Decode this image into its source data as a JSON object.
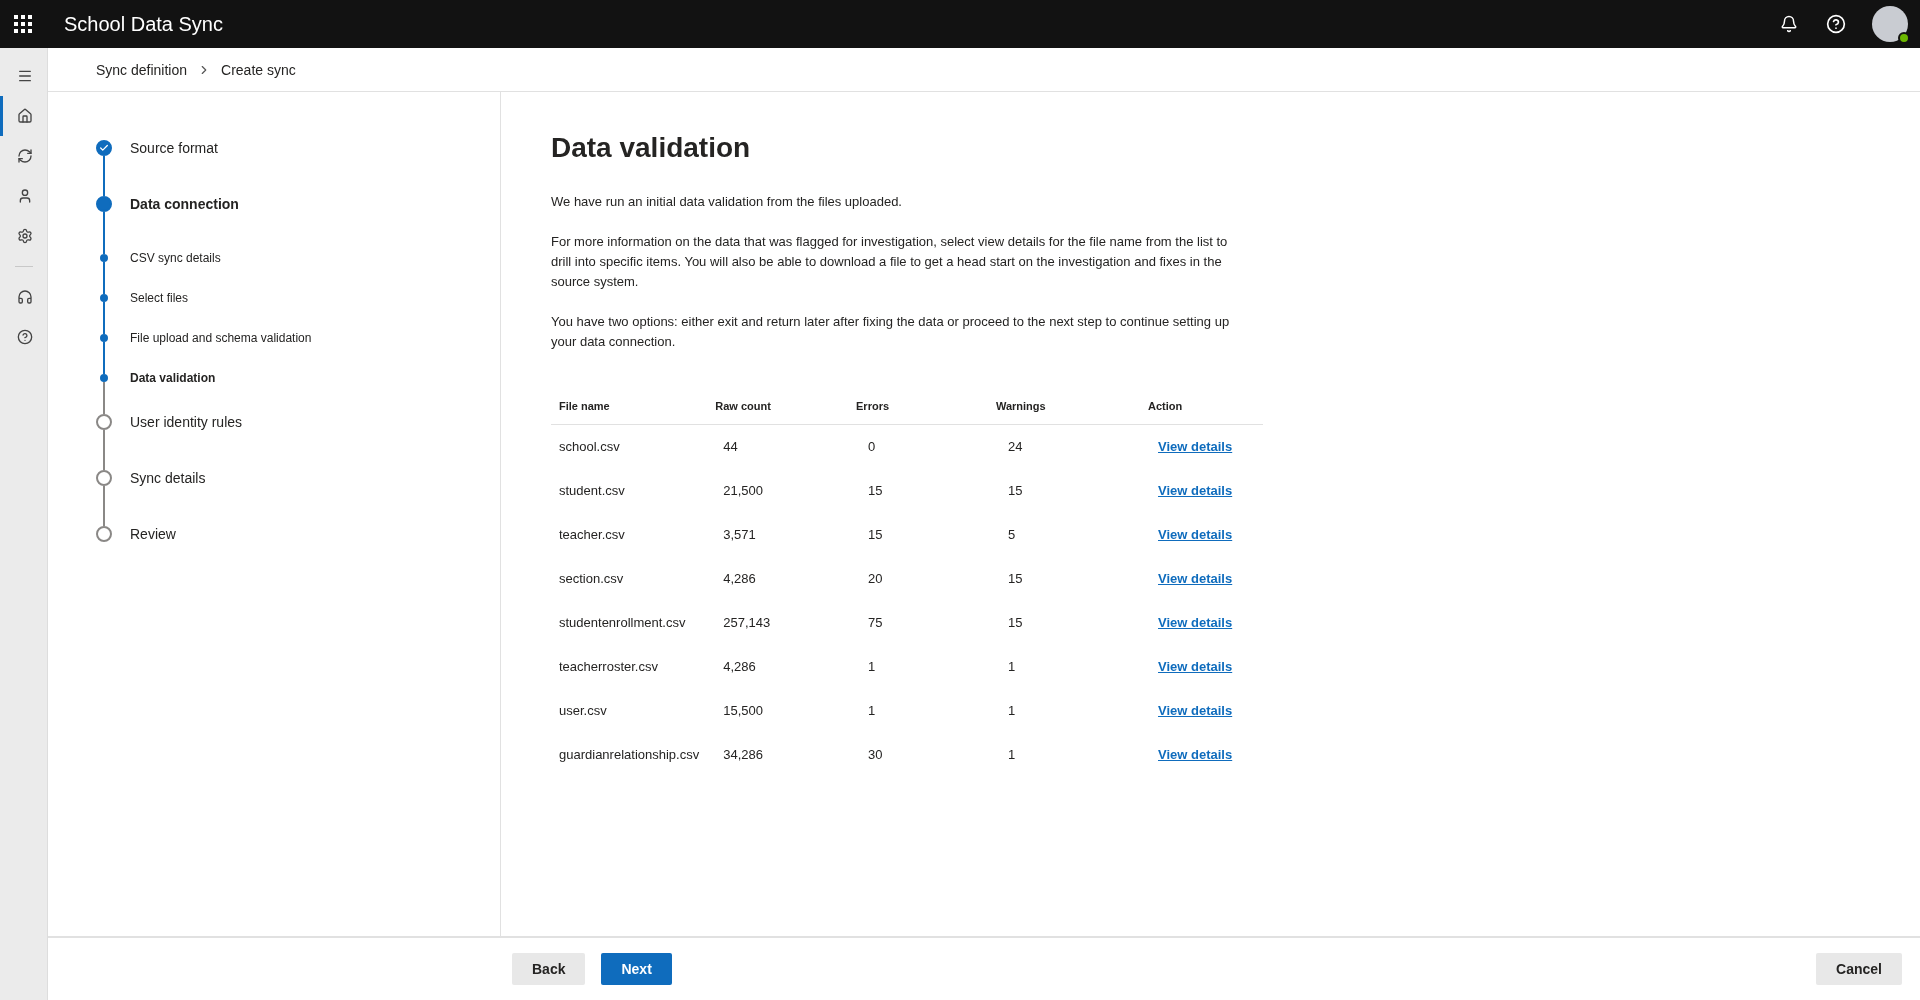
{
  "app": {
    "title": "School Data Sync"
  },
  "rail": [
    {
      "kind": "home",
      "selected": true
    },
    {
      "kind": "sync",
      "selected": false
    },
    {
      "kind": "person",
      "selected": false
    },
    {
      "kind": "settings",
      "selected": false
    },
    {
      "kind": "headset",
      "selected": false
    },
    {
      "kind": "help",
      "selected": false
    }
  ],
  "breadcrumb": [
    "Sync definition",
    "Create sync"
  ],
  "steps": [
    {
      "label": "Source format",
      "kind": "done"
    },
    {
      "label": "Data connection",
      "kind": "current",
      "children": [
        {
          "label": "CSV sync details",
          "selected": false
        },
        {
          "label": "Select files",
          "selected": false
        },
        {
          "label": "File upload and schema validation",
          "selected": false
        },
        {
          "label": "Data validation",
          "selected": true
        }
      ]
    },
    {
      "label": "User identity rules",
      "kind": "pending"
    },
    {
      "label": "Sync details",
      "kind": "pending"
    },
    {
      "label": "Review",
      "kind": "pending"
    }
  ],
  "page": {
    "title": "Data validation",
    "paragraphs": [
      "We have run an initial data validation from the files uploaded.",
      "For more information on the data that was flagged for investigation, select view details for the file name from the list to drill into specific items. You will also be able to download a file to get a head start on the investigation and fixes in the source system.",
      "You have two options: either exit and return later after fixing the data or proceed to the next step to continue setting up your data connection."
    ]
  },
  "table": {
    "columns": [
      "File name",
      "Raw count",
      "Errors",
      "Warnings",
      "Action"
    ],
    "rows": [
      [
        "school.csv",
        "44",
        "0",
        "24",
        "View details"
      ],
      [
        "student.csv",
        "21,500",
        "15",
        "15",
        "View details"
      ],
      [
        "teacher.csv",
        "3,571",
        "15",
        "5",
        "View details"
      ],
      [
        "section.csv",
        "4,286",
        "20",
        "15",
        "View details"
      ],
      [
        "studentenrollment.csv",
        "257,143",
        "75",
        "15",
        "View details"
      ],
      [
        "teacherroster.csv",
        "4,286",
        "1",
        "1",
        "View details"
      ],
      [
        "user.csv",
        "15,500",
        "1",
        "1",
        "View details"
      ],
      [
        "guardianrelationship.csv",
        "34,286",
        "30",
        "1",
        "View details"
      ]
    ]
  },
  "footer": {
    "back": "Back",
    "next": "Next",
    "cancel": "Cancel"
  }
}
